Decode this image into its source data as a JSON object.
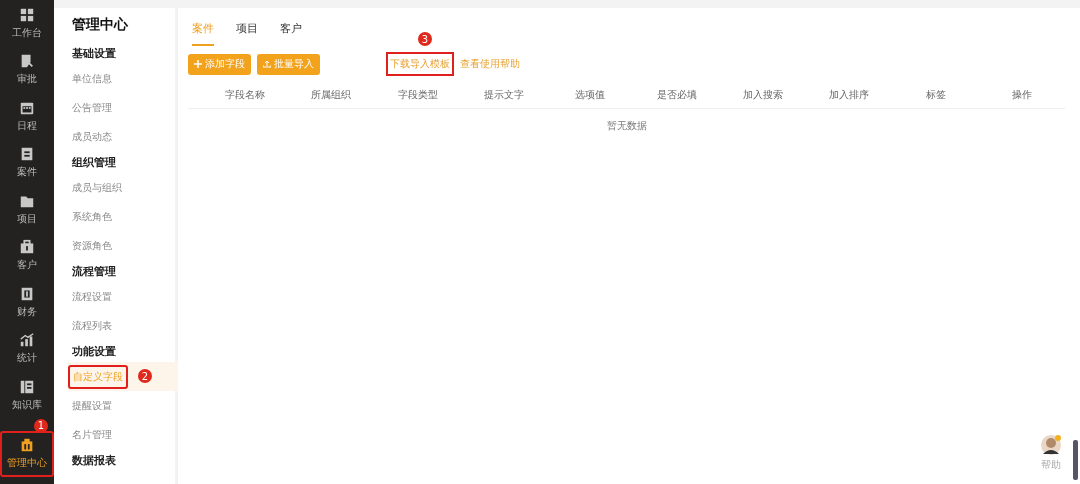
{
  "nav": {
    "items": [
      {
        "label": "工作台",
        "selected": false
      },
      {
        "label": "审批",
        "selected": false
      },
      {
        "label": "日程",
        "selected": false
      },
      {
        "label": "案件",
        "selected": false
      },
      {
        "label": "项目",
        "selected": false
      },
      {
        "label": "客户",
        "selected": false
      },
      {
        "label": "财务",
        "selected": false
      },
      {
        "label": "统计",
        "selected": false
      },
      {
        "label": "知识库",
        "selected": false
      },
      {
        "label": "管理中心",
        "selected": true,
        "annotation": "1"
      }
    ]
  },
  "sidebar": {
    "title": "管理中心",
    "sections": [
      {
        "header": "基础设置",
        "items": [
          {
            "label": "单位信息",
            "selected": false
          },
          {
            "label": "公告管理",
            "selected": false
          },
          {
            "label": "成员动态",
            "selected": false
          }
        ]
      },
      {
        "header": "组织管理",
        "items": [
          {
            "label": "成员与组织",
            "selected": false
          },
          {
            "label": "系统角色",
            "selected": false
          },
          {
            "label": "资源角色",
            "selected": false
          }
        ]
      },
      {
        "header": "流程管理",
        "items": [
          {
            "label": "流程设置",
            "selected": false
          },
          {
            "label": "流程列表",
            "selected": false
          }
        ]
      },
      {
        "header": "功能设置",
        "items": [
          {
            "label": "自定义字段",
            "selected": true,
            "annotation": "2"
          },
          {
            "label": "提醒设置",
            "selected": false
          },
          {
            "label": "名片管理",
            "selected": false
          }
        ]
      },
      {
        "header": "数据报表"
      }
    ]
  },
  "tabs": [
    {
      "label": "案件",
      "selected": true
    },
    {
      "label": "项目",
      "selected": false
    },
    {
      "label": "客户",
      "selected": false
    }
  ],
  "toolbar": {
    "buttons": [
      {
        "label": "添加字段",
        "kind": "add"
      },
      {
        "label": "批量导入",
        "kind": "upload"
      }
    ],
    "links": [
      {
        "label": "下载导入模板",
        "annotation": "3"
      },
      {
        "label": "查看使用帮助"
      }
    ]
  },
  "table": {
    "columns": [
      "字段名称",
      "所属组织",
      "字段类型",
      "提示文字",
      "选项值",
      "是否必填",
      "加入搜索",
      "加入排序",
      "标签",
      "操作"
    ],
    "empty_text": "暂无数据"
  },
  "help_widget": {
    "label": "帮助"
  }
}
